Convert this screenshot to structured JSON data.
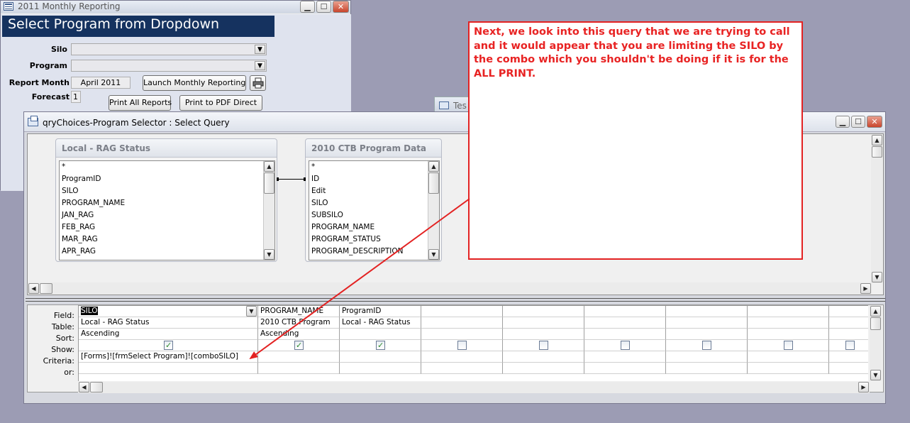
{
  "background_window": {
    "title": "2011 Monthly Reporting",
    "header": "Select Program from Dropdown",
    "silo_label": "Silo",
    "silo_value": "",
    "program_label": "Program",
    "program_value": "",
    "report_month_label": "Report Month",
    "report_month_value": "April 2011",
    "launch_button": "Launch Monthly Reporting",
    "forecast_label": "Forecast",
    "forecast_value": "1",
    "print_all_button": "Print All Reports",
    "print_pdf_button": "Print to PDF Direct"
  },
  "hidden_window": {
    "title_fragment": "Tes"
  },
  "query_window": {
    "title": "qryChoices-Program Selector : Select Query",
    "tables": [
      {
        "name": "Local - RAG Status",
        "fields": [
          "*",
          "ProgramID",
          "SILO",
          "PROGRAM_NAME",
          "JAN_RAG",
          "FEB_RAG",
          "MAR_RAG",
          "APR_RAG"
        ]
      },
      {
        "name": "2010 CTB Program Data",
        "fields": [
          "*",
          "ID",
          "Edit",
          "SILO",
          "SUBSILO",
          "PROGRAM_NAME",
          "PROGRAM_STATUS",
          "PROGRAM_DESCRIPTION"
        ]
      }
    ],
    "grid_row_labels": [
      "Field:",
      "Table:",
      "Sort:",
      "Show:",
      "Criteria:",
      "or:"
    ],
    "columns": [
      {
        "field": "SILO",
        "table": "Local - RAG Status",
        "sort": "Ascending",
        "show": true,
        "criteria": "[Forms]![frmSelect Program]![comboSILO]",
        "or": ""
      },
      {
        "field": "PROGRAM_NAME",
        "table": "2010 CTB Program",
        "sort": "Ascending",
        "show": true,
        "criteria": "",
        "or": ""
      },
      {
        "field": "ProgramID",
        "table": "Local - RAG Status",
        "sort": "",
        "show": true,
        "criteria": "",
        "or": ""
      },
      {
        "field": "",
        "table": "",
        "sort": "",
        "show": false,
        "criteria": "",
        "or": ""
      },
      {
        "field": "",
        "table": "",
        "sort": "",
        "show": false,
        "criteria": "",
        "or": ""
      },
      {
        "field": "",
        "table": "",
        "sort": "",
        "show": false,
        "criteria": "",
        "or": ""
      },
      {
        "field": "",
        "table": "",
        "sort": "",
        "show": false,
        "criteria": "",
        "or": ""
      },
      {
        "field": "",
        "table": "",
        "sort": "",
        "show": false,
        "criteria": "",
        "or": ""
      },
      {
        "field": "",
        "table": "",
        "sort": "",
        "show": false,
        "criteria": "",
        "or": ""
      }
    ]
  },
  "annotation": {
    "text": "Next, we look into this query that we are trying to call and it would appear that you are limiting the SILO by the combo which you shouldn't be doing if it is for the ALL PRINT.",
    "color": "#e32222"
  },
  "icons": [
    "form-icon",
    "query-icon",
    "printer-icon",
    "minimize-icon",
    "maximize-icon",
    "close-icon",
    "chevron-down-icon",
    "scroll-up-icon",
    "scroll-down-icon",
    "scroll-left-icon",
    "scroll-right-icon",
    "checkbox-icon"
  ]
}
